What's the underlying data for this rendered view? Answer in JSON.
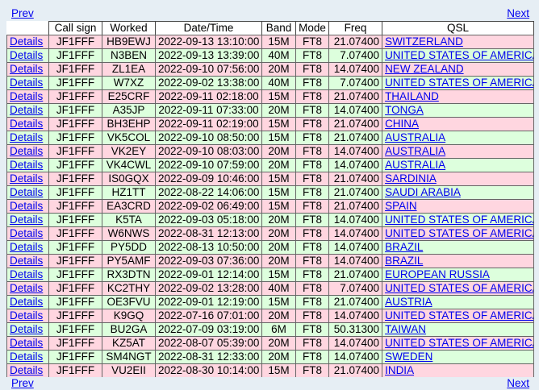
{
  "nav": {
    "prev": "Prev",
    "next": "Next"
  },
  "columns": [
    "Call sign",
    "Worked",
    "Date/Time",
    "Band",
    "Mode",
    "Freq",
    "QSL"
  ],
  "details_label": "Details",
  "rows": [
    {
      "call": "JF1FFF",
      "worked": "HB9EWJ",
      "datetime": "2022-09-13 13:10:00",
      "band": "15M",
      "mode": "FT8",
      "freq": "21.07400",
      "qsl": "SWITZERLAND",
      "color": "pink"
    },
    {
      "call": "JF1FFF",
      "worked": "N3BEN",
      "datetime": "2022-09-13 13:39:00",
      "band": "40M",
      "mode": "FT8",
      "freq": "7.07400",
      "qsl": "UNITED STATES OF AMERICA",
      "color": "green"
    },
    {
      "call": "JF1FFF",
      "worked": "ZL1EA",
      "datetime": "2022-09-10 07:56:00",
      "band": "20M",
      "mode": "FT8",
      "freq": "14.07400",
      "qsl": "NEW ZEALAND",
      "color": "pink"
    },
    {
      "call": "JF1FFF",
      "worked": "W7XZ",
      "datetime": "2022-09-02 13:38:00",
      "band": "40M",
      "mode": "FT8",
      "freq": "7.07400",
      "qsl": "UNITED STATES OF AMERICA",
      "color": "green"
    },
    {
      "call": "JF1FFF",
      "worked": "E25CRF",
      "datetime": "2022-09-11 02:18:00",
      "band": "15M",
      "mode": "FT8",
      "freq": "21.07400",
      "qsl": "THAILAND",
      "color": "pink"
    },
    {
      "call": "JF1FFF",
      "worked": "A35JP",
      "datetime": "2022-09-11 07:33:00",
      "band": "20M",
      "mode": "FT8",
      "freq": "14.07400",
      "qsl": "TONGA",
      "color": "green"
    },
    {
      "call": "JF1FFF",
      "worked": "BH3EHP",
      "datetime": "2022-09-11 02:19:00",
      "band": "15M",
      "mode": "FT8",
      "freq": "21.07400",
      "qsl": "CHINA",
      "color": "pink"
    },
    {
      "call": "JF1FFF",
      "worked": "VK5COL",
      "datetime": "2022-09-10 08:50:00",
      "band": "15M",
      "mode": "FT8",
      "freq": "21.07400",
      "qsl": "AUSTRALIA",
      "color": "green"
    },
    {
      "call": "JF1FFF",
      "worked": "VK2EY",
      "datetime": "2022-09-10 08:03:00",
      "band": "20M",
      "mode": "FT8",
      "freq": "14.07400",
      "qsl": "AUSTRALIA",
      "color": "pink"
    },
    {
      "call": "JF1FFF",
      "worked": "VK4CWL",
      "datetime": "2022-09-10 07:59:00",
      "band": "20M",
      "mode": "FT8",
      "freq": "14.07400",
      "qsl": "AUSTRALIA",
      "color": "green"
    },
    {
      "call": "JF1FFF",
      "worked": "IS0GQX",
      "datetime": "2022-09-09 10:46:00",
      "band": "15M",
      "mode": "FT8",
      "freq": "21.07400",
      "qsl": "SARDINIA",
      "color": "pink"
    },
    {
      "call": "JF1FFF",
      "worked": "HZ1TT",
      "datetime": "2022-08-22 14:06:00",
      "band": "15M",
      "mode": "FT8",
      "freq": "21.07400",
      "qsl": "SAUDI ARABIA",
      "color": "green"
    },
    {
      "call": "JF1FFF",
      "worked": "EA3CRD",
      "datetime": "2022-09-02 06:49:00",
      "band": "15M",
      "mode": "FT8",
      "freq": "21.07400",
      "qsl": "SPAIN",
      "color": "pink"
    },
    {
      "call": "JF1FFF",
      "worked": "K5TA",
      "datetime": "2022-09-03 05:18:00",
      "band": "20M",
      "mode": "FT8",
      "freq": "14.07400",
      "qsl": "UNITED STATES OF AMERICA",
      "color": "green"
    },
    {
      "call": "JF1FFF",
      "worked": "W6NWS",
      "datetime": "2022-08-31 12:13:00",
      "band": "20M",
      "mode": "FT8",
      "freq": "14.07400",
      "qsl": "UNITED STATES OF AMERICA",
      "color": "pink"
    },
    {
      "call": "JF1FFF",
      "worked": "PY5DD",
      "datetime": "2022-08-13 10:50:00",
      "band": "20M",
      "mode": "FT8",
      "freq": "14.07400",
      "qsl": "BRAZIL",
      "color": "green"
    },
    {
      "call": "JF1FFF",
      "worked": "PY5AMF",
      "datetime": "2022-09-03 07:36:00",
      "band": "20M",
      "mode": "FT8",
      "freq": "14.07400",
      "qsl": "BRAZIL",
      "color": "pink"
    },
    {
      "call": "JF1FFF",
      "worked": "RX3DTN",
      "datetime": "2022-09-01 12:14:00",
      "band": "15M",
      "mode": "FT8",
      "freq": "21.07400",
      "qsl": "EUROPEAN RUSSIA",
      "color": "green"
    },
    {
      "call": "JF1FFF",
      "worked": "KC2THY",
      "datetime": "2022-09-02 13:28:00",
      "band": "40M",
      "mode": "FT8",
      "freq": "7.07400",
      "qsl": "UNITED STATES OF AMERICA",
      "color": "pink"
    },
    {
      "call": "JF1FFF",
      "worked": "OE3FVU",
      "datetime": "2022-09-01 12:19:00",
      "band": "15M",
      "mode": "FT8",
      "freq": "21.07400",
      "qsl": "AUSTRIA",
      "color": "green"
    },
    {
      "call": "JF1FFF",
      "worked": "K9GQ",
      "datetime": "2022-07-16 07:01:00",
      "band": "20M",
      "mode": "FT8",
      "freq": "14.07400",
      "qsl": "UNITED STATES OF AMERICA",
      "color": "pink"
    },
    {
      "call": "JF1FFF",
      "worked": "BU2GA",
      "datetime": "2022-07-09 03:19:00",
      "band": "6M",
      "mode": "FT8",
      "freq": "50.31300",
      "qsl": "TAIWAN",
      "color": "green"
    },
    {
      "call": "JF1FFF",
      "worked": "KZ5AT",
      "datetime": "2022-08-07 05:39:00",
      "band": "20M",
      "mode": "FT8",
      "freq": "14.07400",
      "qsl": "UNITED STATES OF AMERICA",
      "color": "pink"
    },
    {
      "call": "JF1FFF",
      "worked": "SM4NGT",
      "datetime": "2022-08-31 12:33:00",
      "band": "20M",
      "mode": "FT8",
      "freq": "14.07400",
      "qsl": "SWEDEN",
      "color": "green"
    },
    {
      "call": "JF1FFF",
      "worked": "VU2EII",
      "datetime": "2022-08-30 10:14:00",
      "band": "15M",
      "mode": "FT8",
      "freq": "21.07400",
      "qsl": "INDIA",
      "color": "pink"
    }
  ]
}
